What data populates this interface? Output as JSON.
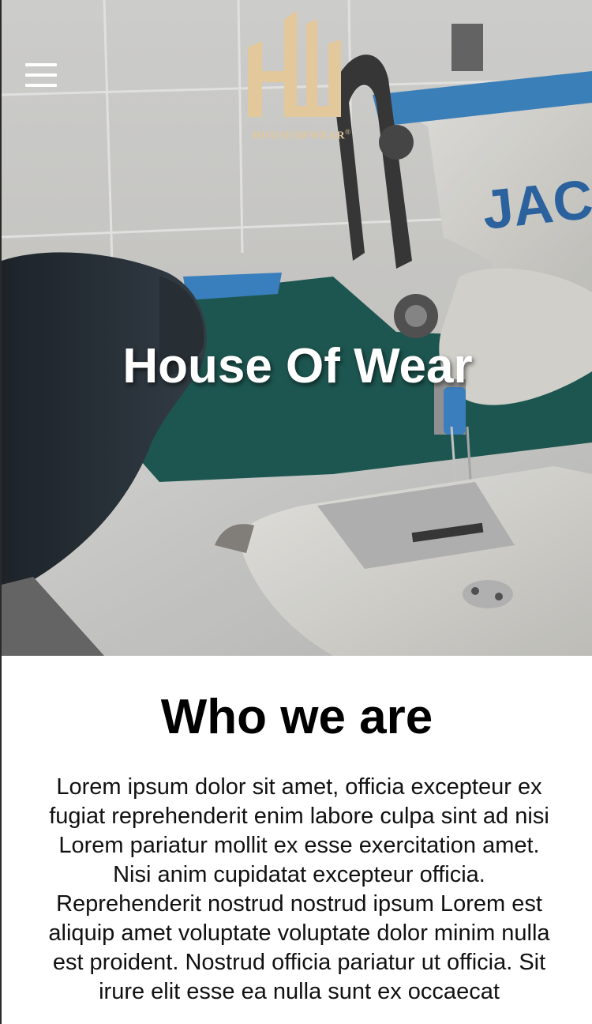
{
  "header": {
    "menu_icon": "hamburger-menu-icon",
    "logo_icon": "house-of-wear-logo",
    "logo_text": "HOUSEOFWEAR",
    "logo_mark": "®",
    "brand_color": "#e3c89b"
  },
  "hero": {
    "title": "House Of Wear",
    "image": "sewing-machine-photo"
  },
  "about": {
    "heading": "Who we are",
    "body": "Lorem ipsum dolor sit amet, officia excepteur ex fugiat reprehenderit enim labore culpa sint ad nisi Lorem pariatur mollit ex esse exercitation amet. Nisi anim cupidatat excepteur officia. Reprehenderit nostrud nostrud ipsum Lorem est aliquip amet voluptate voluptate dolor minim nulla est proident. Nostrud officia pariatur ut officia. Sit irure elit esse ea nulla sunt ex occaecat"
  }
}
